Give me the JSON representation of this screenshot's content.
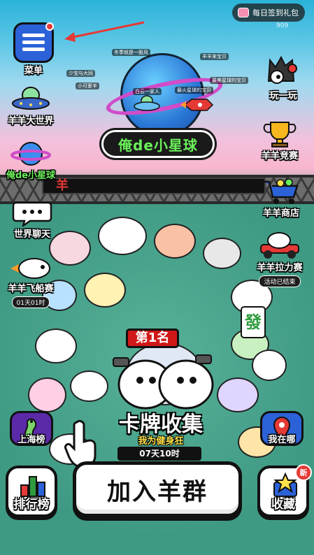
{
  "top_bar": {
    "gift_label": "每日签到礼包",
    "user_id": "909"
  },
  "menu": {
    "label": "菜单"
  },
  "left_column": [
    {
      "id": "sheep-world",
      "label": "羊羊大世界"
    },
    {
      "id": "my-planet",
      "label": "俺de小星球"
    },
    {
      "id": "world-chat",
      "label": "世界聊天"
    },
    {
      "id": "spaceship-race",
      "label": "羊羊飞船赛",
      "timer": "01天01时"
    },
    {
      "id": "shanghai-rank",
      "label": "上海榜"
    }
  ],
  "right_column": [
    {
      "id": "play",
      "label": "玩一玩"
    },
    {
      "id": "sheep-contest",
      "label": "羊羊竞赛"
    },
    {
      "id": "sheep-shop",
      "label": "羊羊商店"
    },
    {
      "id": "tug-race",
      "label": "羊羊拉力赛",
      "status": "活动已结束"
    },
    {
      "id": "where-am-i",
      "label": "我在哪"
    }
  ],
  "planet": {
    "title_part1": "俺de",
    "title_part2": "小星球"
  },
  "marquee": {
    "text": "羊"
  },
  "floating_tags": [
    "冬季就是一股风",
    "少宝与大同",
    "小可爱羊",
    "白云一家人",
    "羊羊来宝贝",
    "最火星球的宝贝",
    "最美星球的宝贝"
  ],
  "card_collection": {
    "rank": "第1名",
    "title": "卡牌收集",
    "subtitle": "我为健身狂",
    "timer": "07天10时"
  },
  "bottom": {
    "ranking_label": "排行榜",
    "join_label": "加入羊群",
    "favorite_label": "收藏",
    "new_badge": "新"
  },
  "colors": {
    "accent_yellow": "#ffe14a",
    "accent_green": "#6af05a",
    "alert_red": "#e53935"
  }
}
